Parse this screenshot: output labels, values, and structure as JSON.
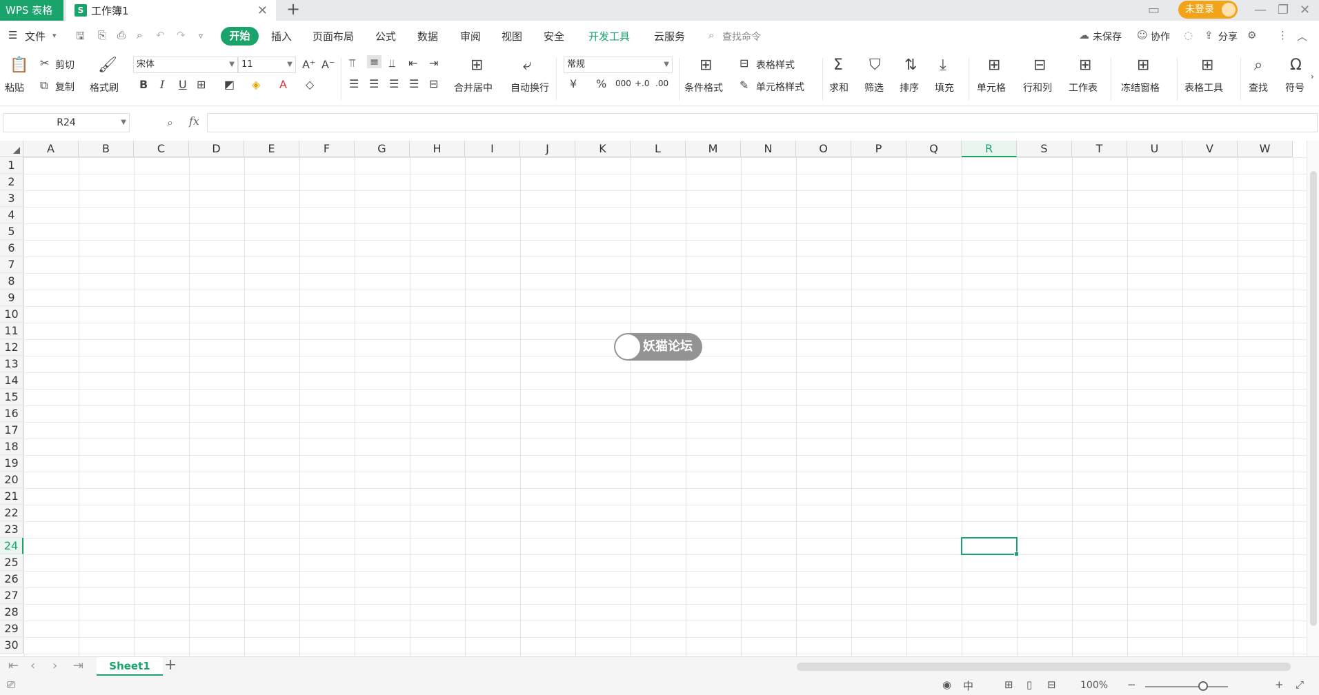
{
  "titlebar": {
    "app_name": "WPS 表格",
    "doc_icon_letter": "S",
    "doc_title": "工作簿1",
    "close_glyph": "✕",
    "new_tab_glyph": "+",
    "login_label": "未登录"
  },
  "menubar": {
    "file_label": "文件",
    "tabs": [
      "开始",
      "插入",
      "页面布局",
      "公式",
      "数据",
      "审阅",
      "视图",
      "安全",
      "开发工具",
      "云服务"
    ],
    "active_tab": "开始",
    "search_label": "查找命令",
    "unsaved_label": "未保存",
    "collab_label": "协作",
    "share_label": "分享"
  },
  "ribbon": {
    "paste": "粘贴",
    "cut": "剪切",
    "copy": "复制",
    "format_painter": "格式刷",
    "font_name": "宋体",
    "font_size": "11",
    "merge_center": "合并居中",
    "wrap_text": "自动换行",
    "number_format": "常规",
    "conditional_format": "条件格式",
    "table_style": "表格样式",
    "cell_style": "单元格样式",
    "sum": "求和",
    "filter": "筛选",
    "sort": "排序",
    "fill": "填充",
    "cells": "单元格",
    "rows_cols": "行和列",
    "worksheet": "工作表",
    "freeze": "冻结窗格",
    "table_tools": "表格工具",
    "find": "查找",
    "symbol": "符号",
    "bold": "B",
    "italic": "I",
    "underline": "U",
    "currency": "¥",
    "percent": "%",
    "thousands": "000",
    "inc_decimal": "+.0",
    "dec_decimal": ".00"
  },
  "formula_bar": {
    "name_box": "R24",
    "fx_label": "fx",
    "formula": ""
  },
  "grid": {
    "columns": [
      "A",
      "B",
      "C",
      "D",
      "E",
      "F",
      "G",
      "H",
      "I",
      "J",
      "K",
      "L",
      "M",
      "N",
      "O",
      "P",
      "Q",
      "R",
      "S",
      "T",
      "U",
      "V",
      "W"
    ],
    "rows": [
      1,
      2,
      3,
      4,
      5,
      6,
      7,
      8,
      9,
      10,
      11,
      12,
      13,
      14,
      15,
      16,
      17,
      18,
      19,
      20,
      21,
      22,
      23,
      24,
      25,
      26,
      27,
      28,
      29,
      30
    ],
    "selected_column": "R",
    "selected_row": 24,
    "watermark": "妖猫论坛"
  },
  "sheets": {
    "tabs": [
      "Sheet1"
    ],
    "active": "Sheet1"
  },
  "status": {
    "zoom": "100%"
  },
  "colors": {
    "accent": "#1aa36b",
    "login": "#f3a318"
  }
}
